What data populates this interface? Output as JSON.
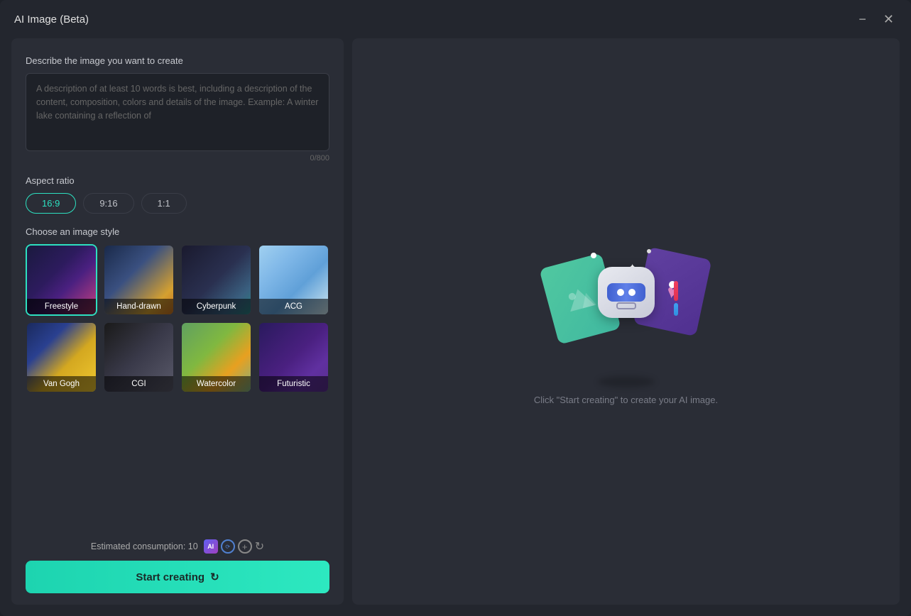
{
  "window": {
    "title": "AI Image (Beta)",
    "minimize_label": "−",
    "close_label": "✕"
  },
  "left_panel": {
    "prompt_section_label": "Describe the image you want to create",
    "prompt_placeholder": "A description of at least 10 words is best, including a description of the content, composition, colors and details of the image. Example: A winter lake containing a reflection of",
    "char_count": "0/800",
    "aspect_ratio_label": "Aspect ratio",
    "aspect_options": [
      {
        "label": "16:9",
        "active": true
      },
      {
        "label": "9:16",
        "active": false
      },
      {
        "label": "1:1",
        "active": false
      }
    ],
    "style_label": "Choose an image style",
    "styles": [
      {
        "key": "freestyle",
        "label": "Freestyle",
        "active": true
      },
      {
        "key": "hand-drawn",
        "label": "Hand-drawn",
        "active": false
      },
      {
        "key": "cyberpunk",
        "label": "Cyberpunk",
        "active": false
      },
      {
        "key": "acg",
        "label": "ACG",
        "active": false
      },
      {
        "key": "van-gogh",
        "label": "Van Gogh",
        "active": false
      },
      {
        "key": "cgi",
        "label": "CGI",
        "active": false
      },
      {
        "key": "watercolor",
        "label": "Watercolor",
        "active": false
      },
      {
        "key": "futuristic",
        "label": "Futuristic",
        "active": false
      }
    ],
    "consumption_label": "Estimated consumption: 10",
    "start_button_label": "Start creating"
  },
  "right_panel": {
    "hint_text": "Click \"Start creating\" to create your AI image."
  }
}
